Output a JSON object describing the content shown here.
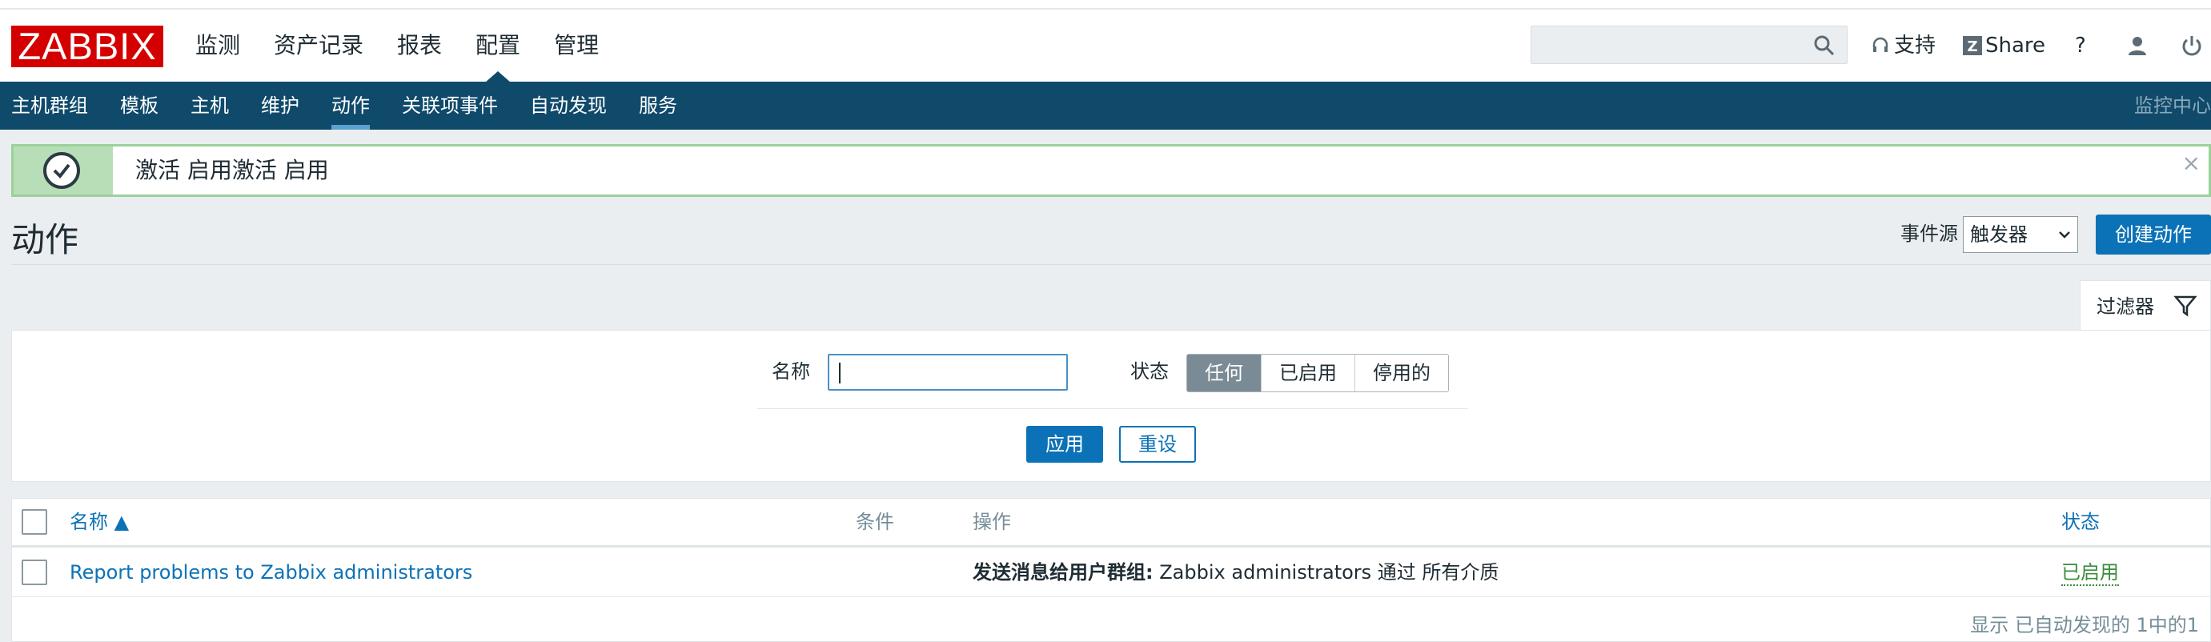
{
  "header": {
    "logo": "ZABBIX",
    "main_menu": [
      "监测",
      "资产记录",
      "报表",
      "配置",
      "管理"
    ],
    "active_main": "配置",
    "search_placeholder": "",
    "support": "支持",
    "share": "Share",
    "help": "?"
  },
  "submenu": {
    "items": [
      "主机群组",
      "模板",
      "主机",
      "维护",
      "动作",
      "关联项事件",
      "自动发现",
      "服务"
    ],
    "active": "动作",
    "right_text": "监控中心"
  },
  "message": {
    "text": "激活 启用激活 启用",
    "close": "×"
  },
  "page": {
    "title": "动作",
    "event_source_label": "事件源",
    "event_source_value": "触发器",
    "create_button": "创建动作"
  },
  "filter": {
    "tab_label": "过滤器",
    "name_label": "名称",
    "name_value": "",
    "status_label": "状态",
    "status_options": [
      "任何",
      "已启用",
      "停用的"
    ],
    "status_selected": "任何",
    "apply": "应用",
    "reset": "重设"
  },
  "table": {
    "columns": {
      "name": "名称 ▲",
      "conditions": "条件",
      "operations": "操作",
      "status": "状态"
    },
    "rows": [
      {
        "name": "Report problems to Zabbix administrators",
        "conditions": "",
        "operations_bold": "发送消息给用户群组:",
        "operations_rest": " Zabbix administrators 通过 所有介质",
        "status": "已启用"
      }
    ],
    "footer": "显示 已自动发现的 1中的1"
  },
  "colors": {
    "brand_red": "#d40000",
    "nav_blue": "#0f4a6b",
    "accent_blue": "#0c72b7",
    "success_green": "#9bd19b",
    "status_enabled": "#3c8c3c"
  }
}
